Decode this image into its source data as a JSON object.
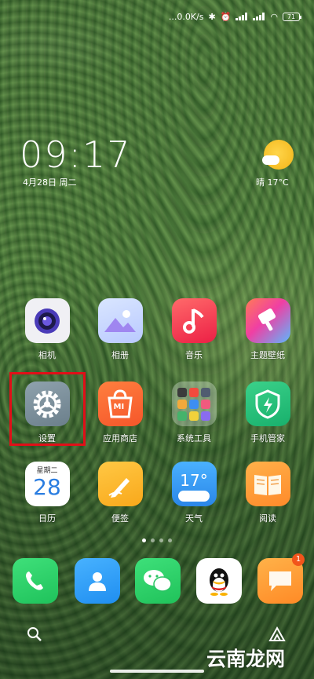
{
  "status_bar": {
    "speed": "...0.0K/s",
    "battery": "71"
  },
  "clock": {
    "time": "09:17",
    "date": "4月28日 周二"
  },
  "weather": {
    "text": "晴  17°C"
  },
  "apps": [
    {
      "label": "相机",
      "icon": "camera-icon"
    },
    {
      "label": "相册",
      "icon": "gallery-icon"
    },
    {
      "label": "音乐",
      "icon": "music-icon"
    },
    {
      "label": "主题壁纸",
      "icon": "themes-icon"
    },
    {
      "label": "设置",
      "icon": "settings-icon"
    },
    {
      "label": "应用商店",
      "icon": "app-store-icon"
    },
    {
      "label": "系统工具",
      "icon": "tools-folder-icon"
    },
    {
      "label": "手机管家",
      "icon": "security-icon"
    },
    {
      "label": "日历",
      "icon": "calendar-icon",
      "sub": "星期二",
      "day": "28"
    },
    {
      "label": "便签",
      "icon": "notes-icon"
    },
    {
      "label": "天气",
      "icon": "weather-app-icon",
      "temp": "17°"
    },
    {
      "label": "阅读",
      "icon": "books-icon"
    }
  ],
  "app_store_text": "MI",
  "dock": [
    {
      "icon": "phone-icon"
    },
    {
      "icon": "contacts-icon"
    },
    {
      "icon": "wechat-icon"
    },
    {
      "icon": "qq-icon"
    },
    {
      "icon": "messages-icon",
      "badge": "1"
    }
  ],
  "watermark": "云南龙网",
  "colors": {
    "highlight": "#e10f18",
    "badge": "#f2541b"
  }
}
